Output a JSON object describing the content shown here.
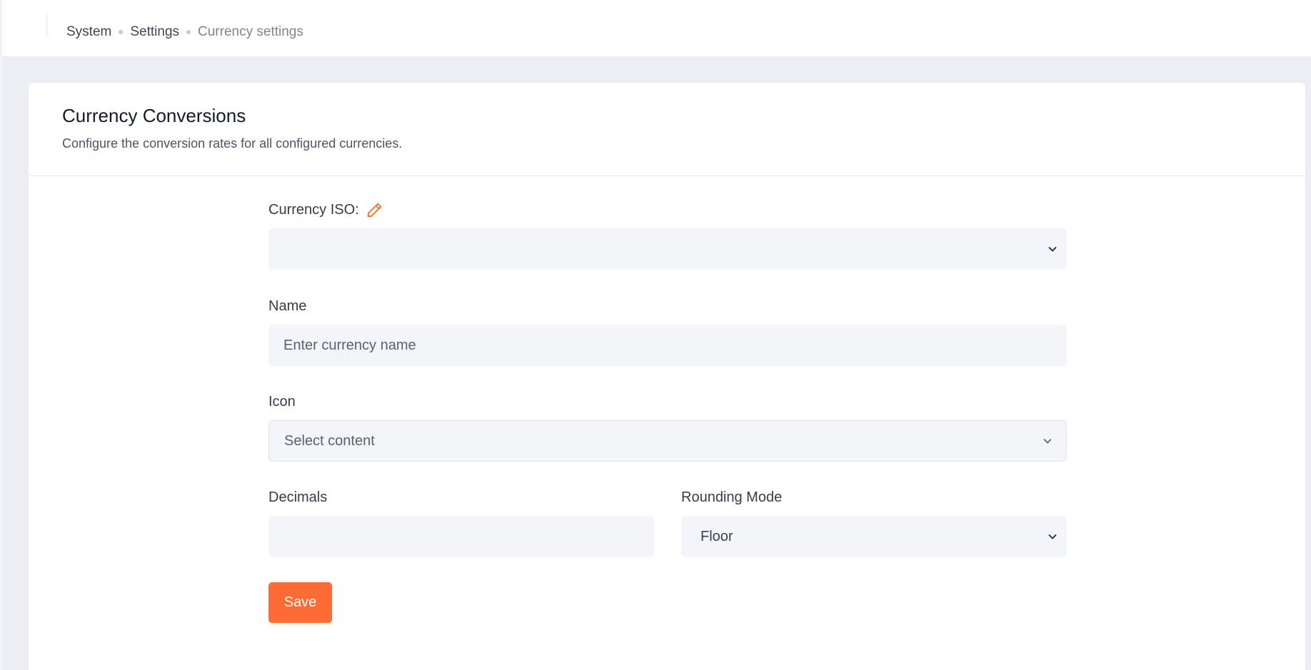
{
  "breadcrumb": {
    "items": [
      "System",
      "Settings",
      "Currency settings"
    ]
  },
  "card": {
    "title": "Currency Conversions",
    "subtitle": "Configure the conversion rates for all configured currencies."
  },
  "form": {
    "currency_iso": {
      "label": "Currency ISO:",
      "value": ""
    },
    "name": {
      "label": "Name",
      "placeholder": "Enter currency name",
      "value": ""
    },
    "icon": {
      "label": "Icon",
      "placeholder": "Select content"
    },
    "decimals": {
      "label": "Decimals",
      "value": ""
    },
    "rounding_mode": {
      "label": "Rounding Mode",
      "value": "Floor"
    },
    "save_label": "Save"
  },
  "colors": {
    "accent": "#fe6b35",
    "page_background": "#eceef4",
    "field_background": "#f3f5f8"
  },
  "icons": {
    "edit": "pencil-icon",
    "dropdown": "chevron-down-icon"
  }
}
